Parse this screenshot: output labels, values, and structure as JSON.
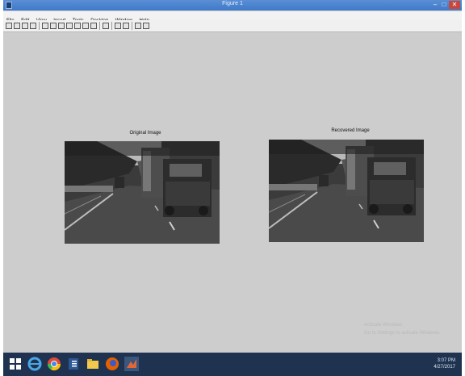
{
  "window": {
    "title": "Figure 1"
  },
  "menu": [
    "File",
    "Edit",
    "View",
    "Insert",
    "Tools",
    "Desktop",
    "Window",
    "Help"
  ],
  "figures": [
    {
      "title": "Original Image"
    },
    {
      "title": "Recovered Image"
    }
  ],
  "watermark": {
    "line1": "Activate Windows",
    "line2": "Go to Settings to activate Windows."
  },
  "clock": {
    "time": "3:07 PM",
    "date": "4/27/2017"
  },
  "colors": {
    "titlebar": "#4a84cf",
    "taskbar": "#1f3350",
    "figure_bg": "#cdcdcd"
  }
}
